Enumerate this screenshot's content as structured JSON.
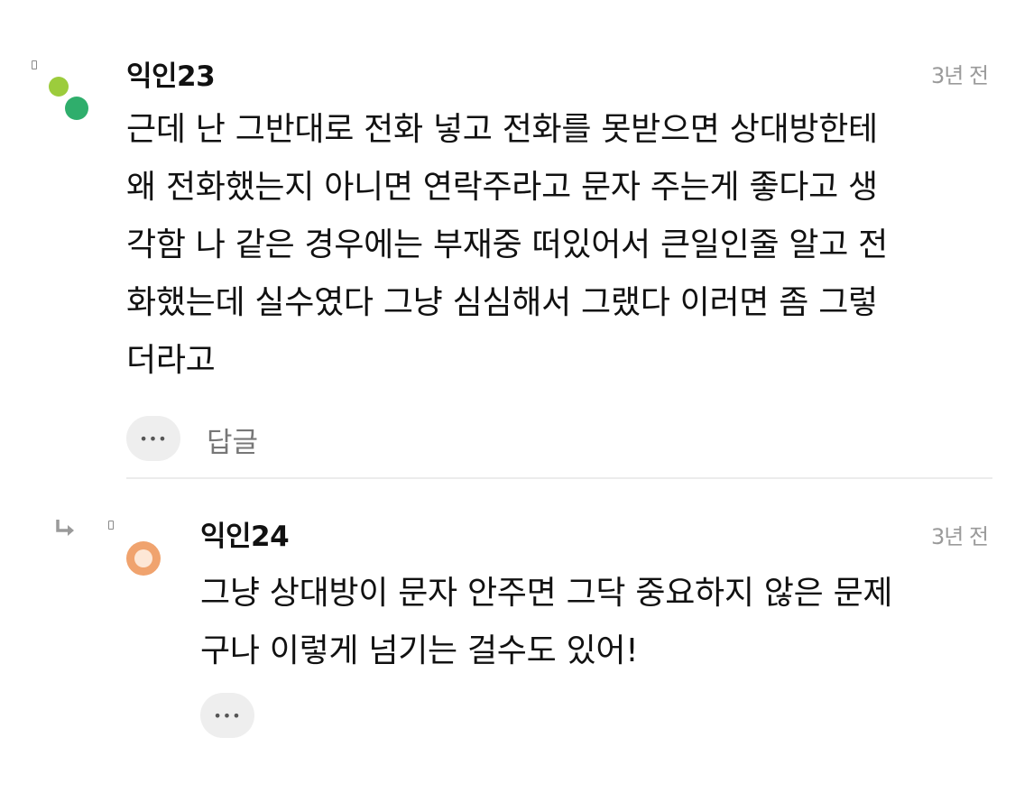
{
  "comments": [
    {
      "username": "익인23",
      "time": "3년 전",
      "lines": [
        "근데 난 그반대로 전화 넣고 전화를 못받으면 상대방한테",
        "왜 전화했는지 아니면 연락주라고 문자 주는게 좋다고 생",
        "각함 나 같은 경우에는 부재중 떠있어서 큰일인줄 알고 전",
        "화했는데 실수였다 그냥 심심해서 그랬다 이러면 좀 그렇",
        "더라고"
      ],
      "more_label": "•••",
      "reply_label": "답글",
      "avatar_colors": [
        "#9ccc3c",
        "#2fae6c"
      ]
    },
    {
      "username": "익인24",
      "time": "3년 전",
      "lines": [
        "그냥 상대방이 문자 안주면 그닥 중요하지 않은 문제",
        "구나 이렇게 넘기는 걸수도 있어!"
      ],
      "more_label": "•••",
      "avatar_colors": [
        "#f0a36e",
        "#fde7d6"
      ]
    }
  ]
}
